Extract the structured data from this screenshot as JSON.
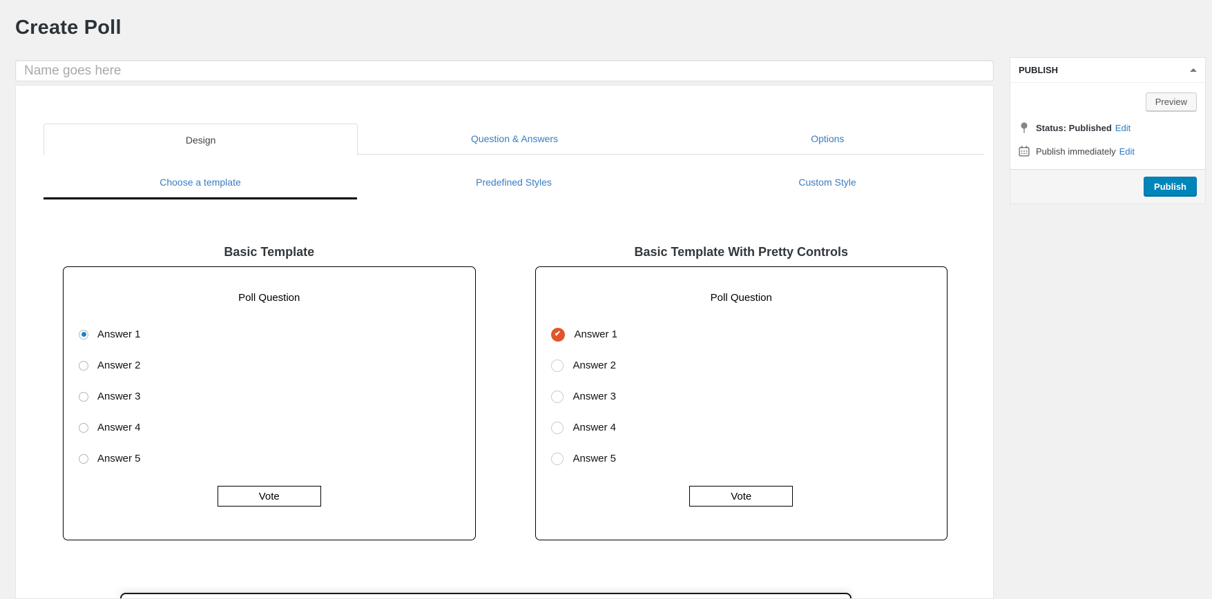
{
  "page": {
    "title": "Create Poll"
  },
  "name_input": {
    "placeholder": "Name goes here"
  },
  "tabs": [
    {
      "label": "Design",
      "active": true
    },
    {
      "label": "Question & Answers",
      "active": false
    },
    {
      "label": "Options",
      "active": false
    }
  ],
  "subtabs": [
    {
      "label": "Choose a template",
      "active": true
    },
    {
      "label": "Predefined Styles",
      "active": false
    },
    {
      "label": "Custom Style",
      "active": false
    }
  ],
  "templates": [
    {
      "title": "Basic Template",
      "question": "Poll Question",
      "answers": [
        "Answer 1",
        "Answer 2",
        "Answer 3",
        "Answer 4",
        "Answer 5"
      ],
      "selected_answer": "Answer 1",
      "vote_label": "Vote",
      "control_style": "basic"
    },
    {
      "title": "Basic Template With Pretty Controls",
      "question": "Poll Question",
      "answers": [
        "Answer 1",
        "Answer 2",
        "Answer 3",
        "Answer 4",
        "Answer 5"
      ],
      "selected_answer": "Answer 1",
      "vote_label": "Vote",
      "control_style": "pretty"
    }
  ],
  "publish_panel": {
    "title": "PUBLISH",
    "preview_button": "Preview",
    "status_text": "Status: Published",
    "status_edit": "Edit",
    "schedule_text": "Publish immediately",
    "schedule_edit": "Edit",
    "publish_button": "Publish"
  },
  "icons": {
    "panel_toggle": "triangle-up-icon",
    "status": "pin-icon",
    "schedule": "calendar-icon",
    "pretty_selected": "check-icon"
  },
  "colors": {
    "page_background": "#f1f1f1",
    "link_blue": "#3a7cc1",
    "publish_button_blue": "#0085ba",
    "basic_radio_selected_blue": "#1f83c4",
    "pretty_radio_selected_orange": "#e0562a",
    "active_subtab_underline": "#000000"
  }
}
